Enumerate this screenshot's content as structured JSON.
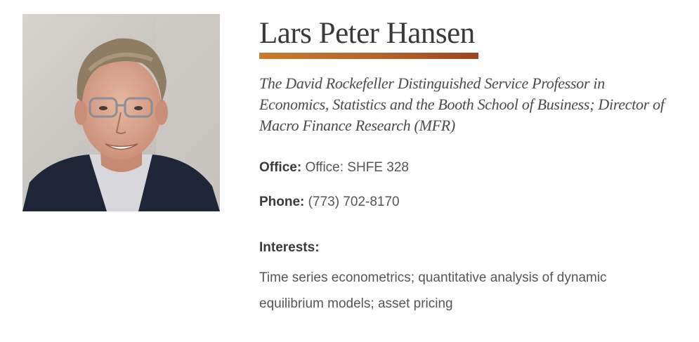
{
  "profile": {
    "photo_icon": "portrait-photo",
    "name": "Lars Peter Hansen",
    "accent_color": "#b5642c",
    "title": "The David Rockefeller Distinguished Service Professor in Economics, Statistics and the Booth School of Business; Director of Macro Finance Research (MFR)",
    "office_label": "Office:",
    "office_value": "Office: SHFE 328",
    "phone_label": "Phone:",
    "phone_value": "(773) 702-8170",
    "interests_heading": "Interests:",
    "interests_text": "Time series econometrics; quantitative analysis of dynamic equilibrium models; asset pricing"
  }
}
